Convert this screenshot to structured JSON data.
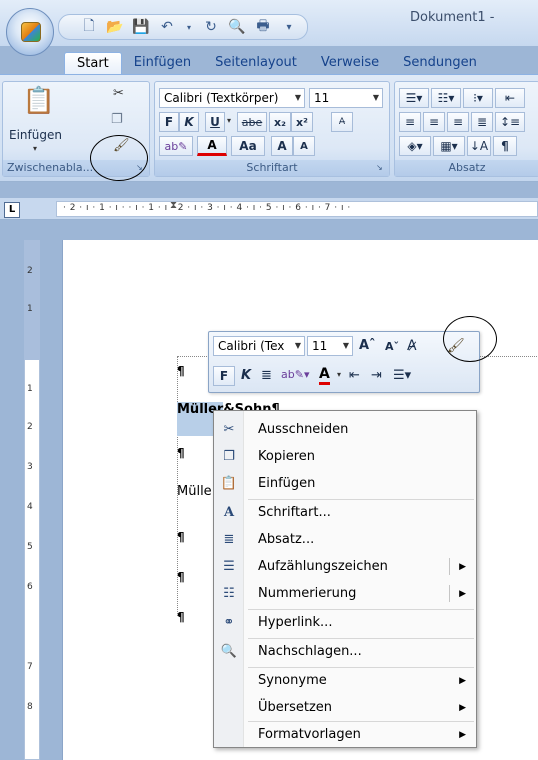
{
  "title_bar": {
    "document_title": "Dokument1 -",
    "qat_separator": "▾"
  },
  "tabs": [
    "Start",
    "Einfügen",
    "Seitenlayout",
    "Verweise",
    "Sendungen"
  ],
  "ribbon": {
    "clipboard": {
      "paste_label": "Einfügen",
      "group_label": "Zwischenabla..."
    },
    "font": {
      "font_name": "Calibri (Textkörper)",
      "font_size": "11",
      "bold": "F",
      "italic": "K",
      "underline": "U",
      "strikethrough": "abe",
      "subscript": "x₂",
      "superscript": "x²",
      "font_color": "A",
      "change_case": "Aa",
      "grow": "A",
      "shrink": "A",
      "group_label": "Schriftart"
    },
    "paragraph": {
      "group_label": "Absatz",
      "pilcrow": "¶"
    }
  },
  "rulers": {
    "corner_label": "L",
    "horizontal_text": "· 2 · ı · 1 · ı ·   · ı · 1 · ı · 2 · ı · 3 · ı · 4 · ı · 5 · ı · 6 · ı · 7 · ı ·",
    "vertical_numbers": [
      "2",
      "1",
      "1",
      "2",
      "3",
      "4",
      "5",
      "6",
      "7",
      "8"
    ]
  },
  "document": {
    "pilcrow": "¶",
    "line1_selected": "Müller",
    "line1_rest": "&Sohn",
    "line2_text": "Mülle"
  },
  "mini_toolbar": {
    "font_name": "Calibri (Tex",
    "font_size": "11",
    "bold": "F",
    "italic": "K",
    "font_color": "A"
  },
  "context_menu": {
    "items": [
      {
        "label": "Ausschneiden",
        "icon": "scissors-icon",
        "glyph": "✂"
      },
      {
        "label": "Kopieren",
        "icon": "copy-icon",
        "glyph": "❐"
      },
      {
        "label": "Einfügen",
        "icon": "paste-icon",
        "glyph": "📋"
      },
      {
        "label": "Schriftart...",
        "icon": "font-icon",
        "glyph": "A"
      },
      {
        "label": "Absatz...",
        "icon": "paragraph-icon",
        "glyph": "≣"
      },
      {
        "label": "Aufzählungszeichen",
        "icon": "bullets-icon",
        "glyph": "☰"
      },
      {
        "label": "Nummerierung",
        "icon": "numbering-icon",
        "glyph": "☷"
      },
      {
        "label": "Hyperlink...",
        "icon": "hyperlink-icon",
        "glyph": "⚭"
      },
      {
        "label": "Nachschlagen...",
        "icon": "research-icon",
        "glyph": "🔍"
      },
      {
        "label": "Synonyme",
        "icon": "",
        "glyph": ""
      },
      {
        "label": "Übersetzen",
        "icon": "",
        "glyph": ""
      },
      {
        "label": "Formatvorlagen",
        "icon": "",
        "glyph": ""
      }
    ]
  },
  "colors": {
    "ribbon_text": "#15428b",
    "selection": "#b8cfe8",
    "workspace": "#9db6d6"
  }
}
